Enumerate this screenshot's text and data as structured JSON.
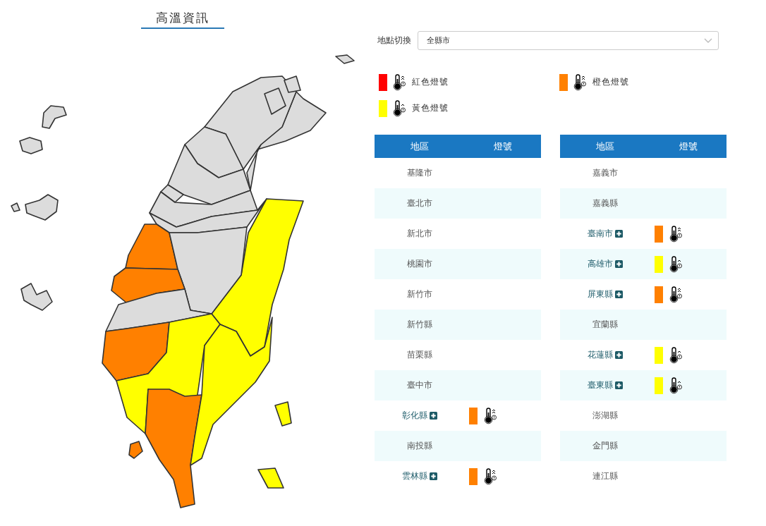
{
  "title": "高溫資訊",
  "location": {
    "label": "地點切換",
    "value": "全縣市"
  },
  "legend": [
    {
      "label": "紅色燈號",
      "color": "#ff0000"
    },
    {
      "label": "橙色燈號",
      "color": "#ff8000"
    },
    {
      "label": "黃色燈號",
      "color": "#ffff00"
    }
  ],
  "tables": [
    {
      "columns": [
        "地區",
        "燈號"
      ],
      "rows": [
        {
          "name": "基隆市"
        },
        {
          "name": "臺北市"
        },
        {
          "name": "新北市"
        },
        {
          "name": "桃園市"
        },
        {
          "name": "新竹市"
        },
        {
          "name": "新竹縣"
        },
        {
          "name": "苗栗縣"
        },
        {
          "name": "臺中市"
        },
        {
          "name": "彰化縣",
          "expandable": true,
          "color": "#ff8000"
        },
        {
          "name": "南投縣"
        },
        {
          "name": "雲林縣",
          "expandable": true,
          "color": "#ff8000"
        }
      ]
    },
    {
      "columns": [
        "地區",
        "燈號"
      ],
      "rows": [
        {
          "name": "嘉義市"
        },
        {
          "name": "嘉義縣"
        },
        {
          "name": "臺南市",
          "expandable": true,
          "color": "#ff8000"
        },
        {
          "name": "高雄市",
          "expandable": true,
          "color": "#ffff00"
        },
        {
          "name": "屏東縣",
          "expandable": true,
          "color": "#ff8000"
        },
        {
          "name": "宜蘭縣"
        },
        {
          "name": "花蓮縣",
          "expandable": true,
          "color": "#ffff00"
        },
        {
          "name": "臺東縣",
          "expandable": true,
          "color": "#ffff00"
        },
        {
          "name": "澎湖縣"
        },
        {
          "name": "金門縣"
        },
        {
          "name": "連江縣"
        }
      ]
    }
  ]
}
